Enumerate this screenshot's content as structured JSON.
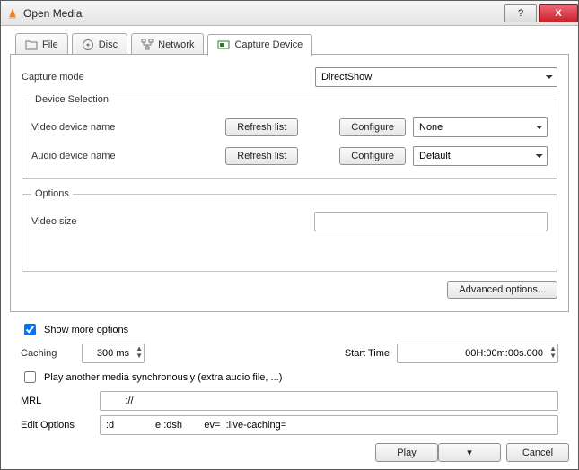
{
  "window": {
    "title": "Open Media",
    "help": "?",
    "close": "X"
  },
  "tabs": {
    "file": "File",
    "disc": "Disc",
    "network": "Network",
    "capture": "Capture Device"
  },
  "capture": {
    "mode_label": "Capture mode",
    "mode_value": "DirectShow",
    "device_legend": "Device Selection",
    "video_label": "Video device name",
    "audio_label": "Audio device name",
    "refresh": "Refresh list",
    "configure": "Configure",
    "video_value": "None",
    "audio_value": "Default",
    "options_legend": "Options",
    "video_size_label": "Video size",
    "video_size_value": "",
    "advanced": "Advanced options..."
  },
  "more": {
    "toggle": "Show more options",
    "caching_label": "Caching",
    "caching_value": "300 ms",
    "start_label": "Start Time",
    "start_value": "00H:00m:00s.000",
    "sync_label": "Play another media synchronously (extra audio file, ...)",
    "mrl_label": "MRL",
    "mrl_value": "       ://",
    "edit_label": "Edit Options",
    "edit_value": ":d               e :dsh        ev=  :live-caching="
  },
  "footer": {
    "play": "Play",
    "cancel": "Cancel"
  }
}
